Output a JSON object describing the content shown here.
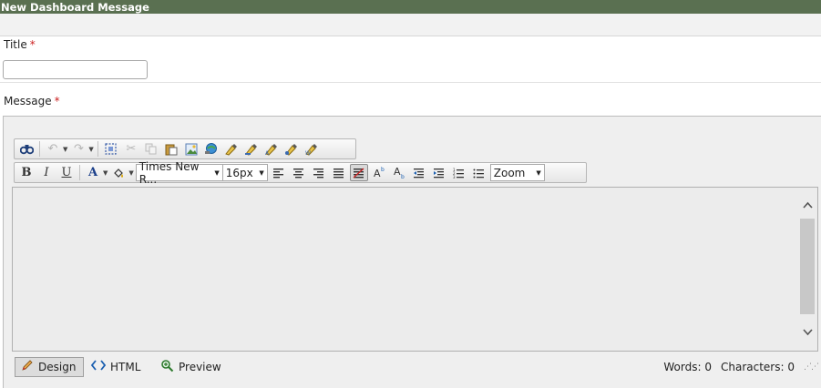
{
  "header": {
    "title": "New Dashboard Message"
  },
  "form": {
    "title_label": "Title",
    "message_label": "Message",
    "required_marker": "*",
    "title_value": ""
  },
  "toolbar1": {
    "icons": [
      "find-icon",
      "undo-icon",
      "redo-icon",
      "select-all-icon",
      "cut-icon",
      "copy-icon",
      "paste-icon",
      "image-manager-icon",
      "hyperlink-manager-icon",
      "format-stripper-icon",
      "document-manager-icon",
      "template-manager-icon",
      "media-manager-icon",
      "flash-manager-icon"
    ]
  },
  "toolbar2": {
    "bold": "B",
    "italic": "I",
    "underline": "U",
    "font_color_glyph": "A",
    "font_name": "Times New R...",
    "font_size": "16px",
    "zoom": "Zoom"
  },
  "modes": {
    "design": "Design",
    "html": "HTML",
    "preview": "Preview"
  },
  "stats": {
    "words_label": "Words:",
    "words": "0",
    "chars_label": "Characters:",
    "chars": "0"
  },
  "colors": {
    "header": "#5a7051",
    "required": "#cc2222"
  }
}
